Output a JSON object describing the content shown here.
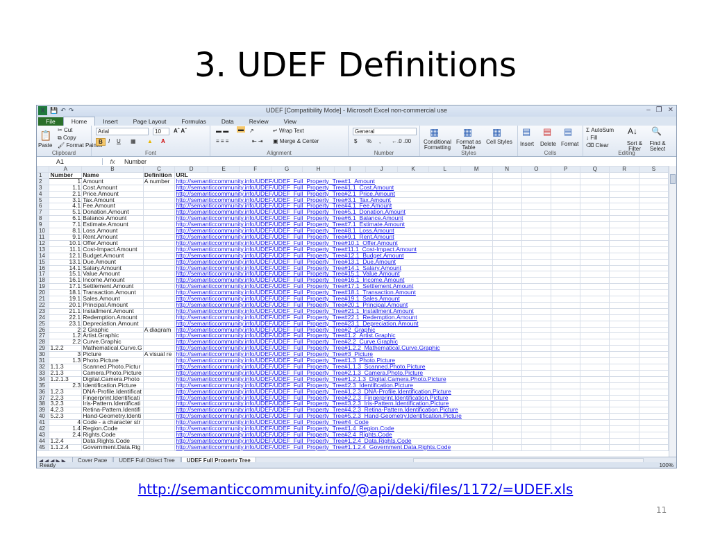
{
  "slide": {
    "title": "3. UDEF Definitions",
    "caption_url": "http://semanticcommunity.info/@api/deki/files/1172/=UDEF.xls",
    "page_number": "11"
  },
  "window": {
    "title": "UDEF  [Compatibility Mode]  -  Microsoft Excel non-commercial use"
  },
  "ribbon": {
    "tabs": [
      "File",
      "Home",
      "Insert",
      "Page Layout",
      "Formulas",
      "Data",
      "Review",
      "View"
    ],
    "active_tab": "Home",
    "clipboard": {
      "paste": "Paste",
      "cut": "Cut",
      "copy": "Copy",
      "format_painter": "Format Painter",
      "label": "Clipboard"
    },
    "font": {
      "name": "Arial",
      "size": "10",
      "bold": "B",
      "italic": "I",
      "underline": "U",
      "label": "Font"
    },
    "alignment": {
      "wrap": "Wrap Text",
      "merge": "Merge & Center",
      "label": "Alignment"
    },
    "number": {
      "format": "General",
      "currency": "$",
      "percent": "%",
      "comma": ",",
      "label": "Number"
    },
    "styles": {
      "conditional": "Conditional Formatting",
      "as_table": "Format as Table",
      "cell_styles": "Cell Styles",
      "label": "Styles"
    },
    "cells": {
      "insert": "Insert",
      "delete": "Delete",
      "format": "Format",
      "label": "Cells"
    },
    "editing": {
      "autosum": "AutoSum",
      "fill": "Fill",
      "clear": "Clear",
      "sort": "Sort & Filter",
      "find": "Find & Select",
      "label": "Editing"
    }
  },
  "formula_bar": {
    "name_box": "A1",
    "fx": "fx",
    "content": "Number"
  },
  "sheet": {
    "columns": [
      "A",
      "B",
      "C",
      "D",
      "E",
      "F",
      "G",
      "H",
      "I",
      "J",
      "K",
      "L",
      "M",
      "N",
      "O",
      "P",
      "Q",
      "R",
      "S"
    ],
    "rows": [
      {
        "n": "1",
        "a": "Number",
        "b": "Name",
        "c": "Definition",
        "d": "URL"
      },
      {
        "n": "2",
        "a": "1",
        "b": "Amount",
        "c": "A number",
        "d": "http://semanticcommunity.info/UDEF/UDEF_Full_Property_Tree#1_Amount"
      },
      {
        "n": "3",
        "a": "1.1",
        "b": "Cost.Amount",
        "c": "",
        "d": "http://semanticcommunity.info/UDEF/UDEF_Full_Property_Tree#1.1_Cost.Amount"
      },
      {
        "n": "4",
        "a": "2.1",
        "b": "Price.Amount",
        "c": "",
        "d": "http://semanticcommunity.info/UDEF/UDEF_Full_Property_Tree#2.1_Price.Amount"
      },
      {
        "n": "5",
        "a": "3.1",
        "b": "Tax.Amount",
        "c": "",
        "d": "http://semanticcommunity.info/UDEF/UDEF_Full_Property_Tree#3.1_Tax.Amount"
      },
      {
        "n": "6",
        "a": "4.1",
        "b": "Fee.Amount",
        "c": "",
        "d": "http://semanticcommunity.info/UDEF/UDEF_Full_Property_Tree#4.1_Fee.Amount"
      },
      {
        "n": "7",
        "a": "5.1",
        "b": "Donation.Amount",
        "c": "",
        "d": "http://semanticcommunity.info/UDEF/UDEF_Full_Property_Tree#5.1_Donation.Amount"
      },
      {
        "n": "8",
        "a": "6.1",
        "b": "Balance.Amount",
        "c": "",
        "d": "http://semanticcommunity.info/UDEF/UDEF_Full_Property_Tree#6.1_Balance.Amount"
      },
      {
        "n": "9",
        "a": "7.1",
        "b": "Estimate.Amount",
        "c": "",
        "d": "http://semanticcommunity.info/UDEF/UDEF_Full_Property_Tree#7.1_Estimate.Amount"
      },
      {
        "n": "10",
        "a": "8.1",
        "b": "Loss.Amount",
        "c": "",
        "d": "http://semanticcommunity.info/UDEF/UDEF_Full_Property_Tree#8.1_Loss.Amount"
      },
      {
        "n": "11",
        "a": "9.1",
        "b": "Rent.Amount",
        "c": "",
        "d": "http://semanticcommunity.info/UDEF/UDEF_Full_Property_Tree#9.1_Rent.Amount"
      },
      {
        "n": "12",
        "a": "10.1",
        "b": "Offer.Amount",
        "c": "",
        "d": "http://semanticcommunity.info/UDEF/UDEF_Full_Property_Tree#10.1_Offer.Amount"
      },
      {
        "n": "13",
        "a": "11.1",
        "b": "Cost-Impact.Amount",
        "c": "",
        "d": "http://semanticcommunity.info/UDEF/UDEF_Full_Property_Tree#11.1_Cost-Impact.Amount"
      },
      {
        "n": "14",
        "a": "12.1",
        "b": "Budget.Amount",
        "c": "",
        "d": "http://semanticcommunity.info/UDEF/UDEF_Full_Property_Tree#12.1_Budget.Amount"
      },
      {
        "n": "15",
        "a": "13.1",
        "b": "Due.Amount",
        "c": "",
        "d": "http://semanticcommunity.info/UDEF/UDEF_Full_Property_Tree#13.1_Due.Amount"
      },
      {
        "n": "16",
        "a": "14.1",
        "b": "Salary.Amount",
        "c": "",
        "d": "http://semanticcommunity.info/UDEF/UDEF_Full_Property_Tree#14.1_Salary.Amount"
      },
      {
        "n": "17",
        "a": "15.1",
        "b": "Value.Amount",
        "c": "",
        "d": "http://semanticcommunity.info/UDEF/UDEF_Full_Property_Tree#15.1_Value.Amount"
      },
      {
        "n": "18",
        "a": "16.1",
        "b": "Income.Amount",
        "c": "",
        "d": "http://semanticcommunity.info/UDEF/UDEF_Full_Property_Tree#16.1_Income.Amount"
      },
      {
        "n": "19",
        "a": "17.1",
        "b": "Settlement.Amount",
        "c": "",
        "d": "http://semanticcommunity.info/UDEF/UDEF_Full_Property_Tree#17.1_Settlement.Amount"
      },
      {
        "n": "20",
        "a": "18.1",
        "b": "Transaction.Amount",
        "c": "",
        "d": "http://semanticcommunity.info/UDEF/UDEF_Full_Property_Tree#18.1_Transaction.Amount"
      },
      {
        "n": "21",
        "a": "19.1",
        "b": "Sales.Amount",
        "c": "",
        "d": "http://semanticcommunity.info/UDEF/UDEF_Full_Property_Tree#19.1_Sales.Amount"
      },
      {
        "n": "22",
        "a": "20.1",
        "b": "Principal.Amount",
        "c": "",
        "d": "http://semanticcommunity.info/UDEF/UDEF_Full_Property_Tree#20.1_Principal.Amount"
      },
      {
        "n": "23",
        "a": "21.1",
        "b": "Installment.Amount",
        "c": "",
        "d": "http://semanticcommunity.info/UDEF/UDEF_Full_Property_Tree#21.1_Installment.Amount"
      },
      {
        "n": "24",
        "a": "22.1",
        "b": "Redemption.Amount",
        "c": "",
        "d": "http://semanticcommunity.info/UDEF/UDEF_Full_Property_Tree#22.1_Redemption.Amount"
      },
      {
        "n": "25",
        "a": "23.1",
        "b": "Depreciation.Amount",
        "c": "",
        "d": "http://semanticcommunity.info/UDEF/UDEF_Full_Property_Tree#23.1_Depreciation.Amount"
      },
      {
        "n": "26",
        "a": "2",
        "b": "2 Graphic",
        "c": "A diagram",
        "d": "http://semanticcommunity.info/UDEF/UDEF_Full_Property_Tree#2_Graphic"
      },
      {
        "n": "27",
        "a": "1.2",
        "b": "Artist.Graphic",
        "c": "",
        "d": "http://semanticcommunity.info/UDEF/UDEF_Full_Property_Tree#1.2_Artist.Graphic"
      },
      {
        "n": "28",
        "a": "2.2",
        "b": "Curve.Graphic",
        "c": "",
        "d": "http://semanticcommunity.info/UDEF/UDEF_Full_Property_Tree#2.2_Curve.Graphic"
      },
      {
        "n": "29",
        "a": "1.2.2",
        "b": "Mathematical.Curve.G",
        "c": "",
        "d": "http://semanticcommunity.info/UDEF/UDEF_Full_Property_Tree#1.2.2_Mathematical.Curve.Graphic",
        "left": true
      },
      {
        "n": "30",
        "a": "3",
        "b": "Picture",
        "c": "A visual re",
        "d": "http://semanticcommunity.info/UDEF/UDEF_Full_Property_Tree#3_Picture"
      },
      {
        "n": "31",
        "a": "1.3",
        "b": "Photo.Picture",
        "c": "",
        "d": "http://semanticcommunity.info/UDEF/UDEF_Full_Property_Tree#1.3_Photo.Picture"
      },
      {
        "n": "32",
        "a": "1.1.3",
        "b": "Scanned.Photo.Pictur",
        "c": "",
        "d": "http://semanticcommunity.info/UDEF/UDEF_Full_Property_Tree#1.1.3_Scanned.Photo.Picture",
        "left": true
      },
      {
        "n": "33",
        "a": "2.1.3",
        "b": "Camera.Photo.Picture",
        "c": "",
        "d": "http://semanticcommunity.info/UDEF/UDEF_Full_Property_Tree#2.1.3_Camera.Photo.Picture",
        "left": true
      },
      {
        "n": "34",
        "a": "1.2.1.3",
        "b": "Digital.Camera.Photo",
        "c": "",
        "d": "http://semanticcommunity.info/UDEF/UDEF_Full_Property_Tree#1.2.1.3_Digital.Camera.Photo.Picture",
        "left": true
      },
      {
        "n": "35",
        "a": "2.3",
        "b": "Identification.Picture",
        "c": "",
        "d": "http://semanticcommunity.info/UDEF/UDEF_Full_Property_Tree#2.3_Identification.Picture"
      },
      {
        "n": "36",
        "a": "1.2.3",
        "b": "DNA-Profile.Identificat",
        "c": "",
        "d": "http://semanticcommunity.info/UDEF/UDEF_Full_Property_Tree#1.2.3_DNA-Profile.Identification.Picture",
        "left": true
      },
      {
        "n": "37",
        "a": "2.2.3",
        "b": "Fingerprint.Identificati",
        "c": "",
        "d": "http://semanticcommunity.info/UDEF/UDEF_Full_Property_Tree#2.2.3_Fingerprint.Identification.Picture",
        "left": true
      },
      {
        "n": "38",
        "a": "3.2.3",
        "b": "Iris-Pattern.Identificati",
        "c": "",
        "d": "http://semanticcommunity.info/UDEF/UDEF_Full_Property_Tree#3.2.3_Iris-Pattern.Identification.Picture",
        "left": true
      },
      {
        "n": "39",
        "a": "4.2.3",
        "b": "Retina-Pattern.Identifi",
        "c": "",
        "d": "http://semanticcommunity.info/UDEF/UDEF_Full_Property_Tree#4.2.3_Retina-Pattern.Identification.Picture",
        "left": true
      },
      {
        "n": "40",
        "a": "5.2.3",
        "b": "Hand-Geometry.Identi",
        "c": "",
        "d": "http://semanticcommunity.info/UDEF/UDEF_Full_Property_Tree#5.2.3_Hand-Geometry.Identification.Picture",
        "left": true
      },
      {
        "n": "41",
        "a": "4",
        "b": "Code - a character str",
        "c": "",
        "d": "http://semanticcommunity.info/UDEF/UDEF_Full_Property_Tree#4_Code"
      },
      {
        "n": "42",
        "a": "1.4",
        "b": "Region.Code",
        "c": "",
        "d": "http://semanticcommunity.info/UDEF/UDEF_Full_Property_Tree#1.4_Region.Code"
      },
      {
        "n": "43",
        "a": "2.4",
        "b": "Rights.Code",
        "c": "",
        "d": "http://semanticcommunity.info/UDEF/UDEF_Full_Property_Tree#2.4_Rights.Code"
      },
      {
        "n": "44",
        "a": "1.2.4",
        "b": "Data.Rights.Code",
        "c": "",
        "d": "http://semanticcommunity.info/UDEF/UDEF_Full_Property_Tree#1.2.4_Data.Rights.Code",
        "left": true
      },
      {
        "n": "45",
        "a": "1.1.2.4",
        "b": "Government.Data.Rig",
        "c": "",
        "d": "http://semanticcommunity.info/UDEF/UDEF_Full_Property_Tree#1.1.2.4_Government.Data.Rights.Code",
        "left": true
      }
    ]
  },
  "sheet_tabs": [
    "Cover Page",
    "UDEF Full Object Tree",
    "UDEF Full Property Tree"
  ],
  "active_sheet": "UDEF Full Property Tree",
  "status": {
    "ready": "Ready",
    "zoom": "100%"
  }
}
